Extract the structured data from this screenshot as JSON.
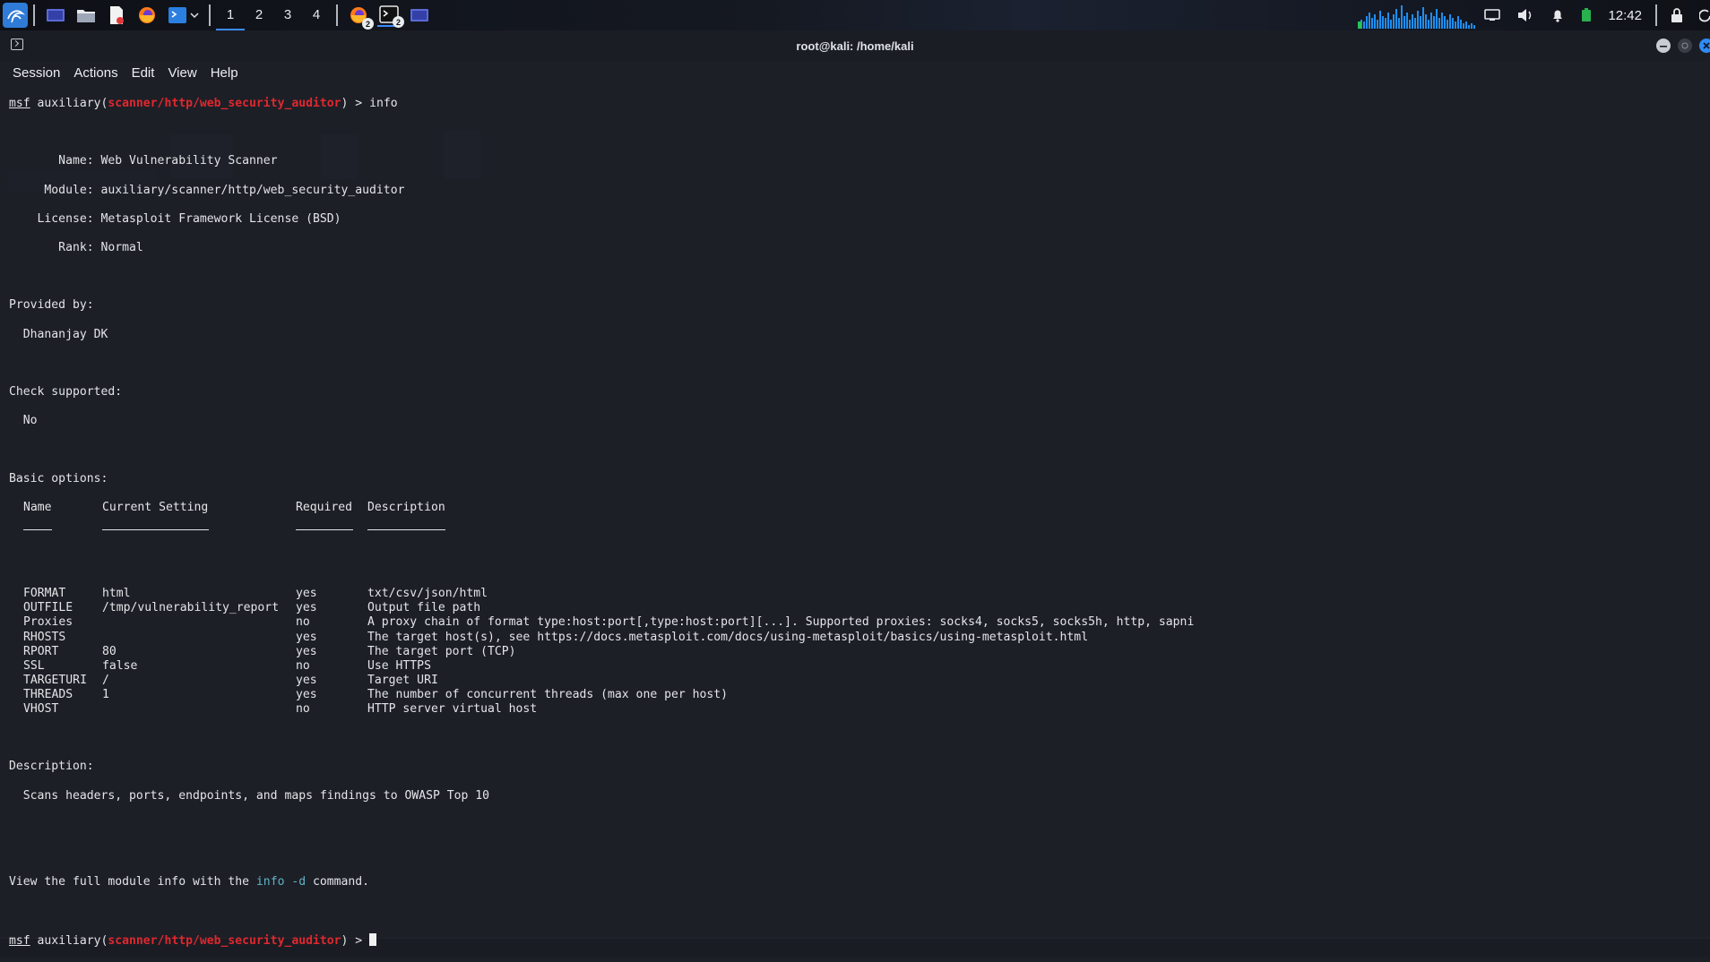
{
  "panel": {
    "workspaces": [
      "1",
      "2",
      "3",
      "4"
    ],
    "active_workspace": "1",
    "firefox_badge": "2",
    "terminal_badge": "2",
    "clock": "12:42",
    "accent_color": "#3b8bfd"
  },
  "window": {
    "title": "root@kali: /home/kali"
  },
  "menu": {
    "items": [
      "Session",
      "Actions",
      "Edit",
      "View",
      "Help"
    ]
  },
  "terminal": {
    "prompt1": {
      "msf": "msf",
      "prefix": " auxiliary(",
      "module": "scanner/http/web_security_auditor",
      "suffix": ") > info"
    },
    "info_lines": [
      "       Name: Web Vulnerability Scanner",
      "     Module: auxiliary/scanner/http/web_security_auditor",
      "    License: Metasploit Framework License (BSD)",
      "       Rank: Normal"
    ],
    "provided_by_label": "Provided by:",
    "provided_by_value": "  Dhananjay DK",
    "check_label": "Check supported:",
    "check_value": "  No",
    "basic_options_label": "Basic options:",
    "columns": {
      "name": "Name",
      "setting": "Current Setting",
      "required": "Required",
      "description": "Description"
    },
    "options": [
      {
        "name": "FORMAT",
        "setting": "html",
        "required": "yes",
        "description": "txt/csv/json/html"
      },
      {
        "name": "OUTFILE",
        "setting": "/tmp/vulnerability_report",
        "required": "yes",
        "description": "Output file path"
      },
      {
        "name": "Proxies",
        "setting": "",
        "required": "no",
        "description": "A proxy chain of format type:host:port[,type:host:port][...]. Supported proxies: socks4, socks5, socks5h, http, sapni"
      },
      {
        "name": "RHOSTS",
        "setting": "",
        "required": "yes",
        "description": "The target host(s), see https://docs.metasploit.com/docs/using-metasploit/basics/using-metasploit.html"
      },
      {
        "name": "RPORT",
        "setting": "80",
        "required": "yes",
        "description": "The target port (TCP)"
      },
      {
        "name": "SSL",
        "setting": "false",
        "required": "no",
        "description": "Use HTTPS"
      },
      {
        "name": "TARGETURI",
        "setting": "/",
        "required": "yes",
        "description": "Target URI"
      },
      {
        "name": "THREADS",
        "setting": "1",
        "required": "yes",
        "description": "The number of concurrent threads (max one per host)"
      },
      {
        "name": "VHOST",
        "setting": "",
        "required": "no",
        "description": "HTTP server virtual host"
      }
    ],
    "description_label": "Description:",
    "description_value": "  Scans headers, ports, endpoints, and maps findings to OWASP Top 10",
    "view_full_prefix": "View the full module info with the ",
    "view_full_cmd": "info -d",
    "view_full_suffix": " command.",
    "prompt2": {
      "msf": "msf",
      "prefix": " auxiliary(",
      "module": "scanner/http/web_security_auditor",
      "suffix": ") > "
    }
  }
}
